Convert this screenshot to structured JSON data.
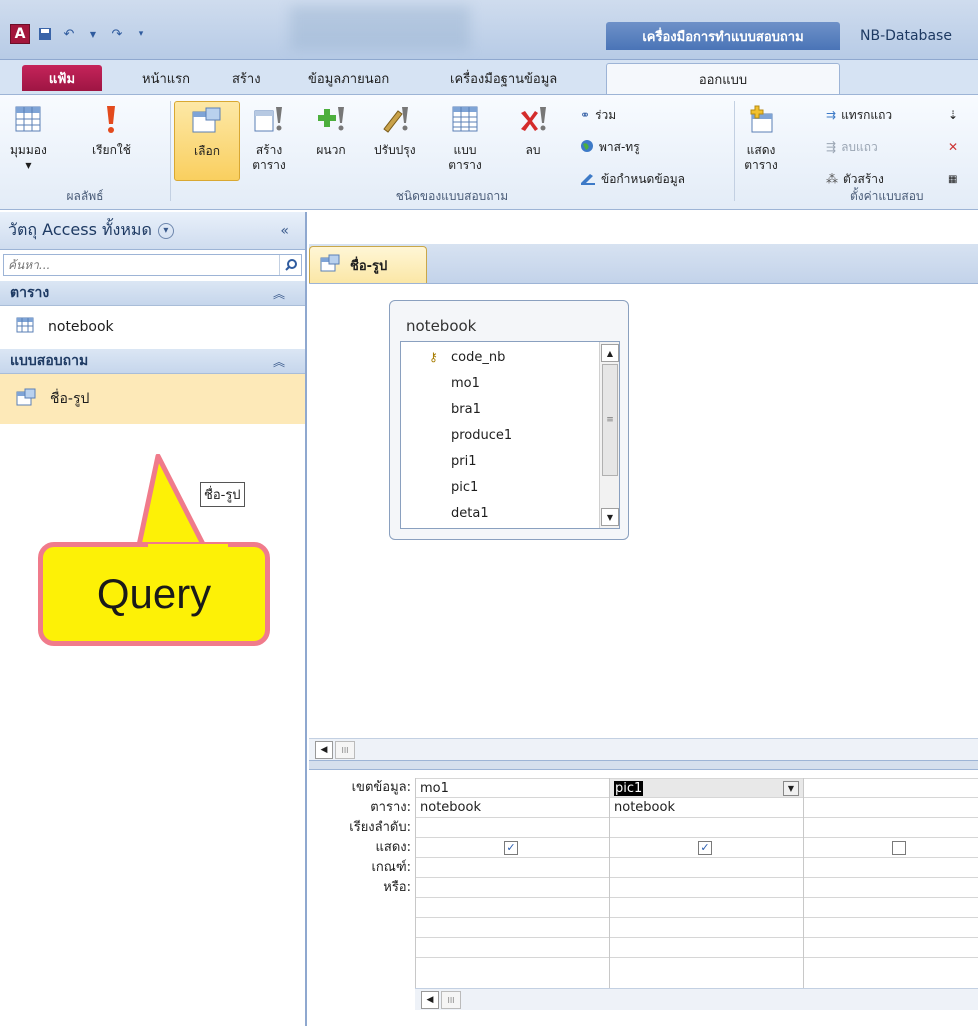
{
  "titlebar": {
    "context_tab_title": "เครื่องมือการทำแบบสอบถาม",
    "window_title": "NB-Database"
  },
  "tabs": {
    "file": "แฟ้ม",
    "home": "หน้าแรก",
    "create": "สร้าง",
    "external": "ข้อมูลภายนอก",
    "dbtools": "เครื่องมือฐานข้อมูล",
    "design": "ออกแบบ"
  },
  "ribbon": {
    "view": "มุมมอง",
    "run": "เรียกใช้",
    "results_group": "ผลลัพธ์",
    "select": "เลือก",
    "make_table_1": "สร้าง",
    "make_table_2": "ตาราง",
    "append": "ผนวก",
    "update": "ปรับปรุง",
    "crosstab_1": "แบบ",
    "crosstab_2": "ตาราง",
    "delete": "ลบ",
    "union": "ร่วม",
    "pass_through": "พาส-ทรู",
    "data_definition": "ข้อกำหนดข้อมูล",
    "query_type_group": "ชนิดของแบบสอบถาม",
    "show_table_1": "แสดง",
    "show_table_2": "ตาราง",
    "insert_rows": "แทรกแถว",
    "delete_rows": "ลบแถว",
    "builder": "ตัวสร้าง",
    "query_setup_group": "ตั้งค่าแบบสอบ"
  },
  "nav": {
    "header": "วัตถุ Access ทั้งหมด",
    "search_placeholder": "ค้นหา...",
    "sections": [
      {
        "title": "ตาราง",
        "items": [
          "notebook"
        ]
      },
      {
        "title": "แบบสอบถาม",
        "items": [
          "ชื่อ-รูป"
        ]
      }
    ],
    "tooltip": "ชื่อ-รูป"
  },
  "callout": {
    "text": "Query"
  },
  "document": {
    "tab_title": "ชื่อ-รูป",
    "table": {
      "name": "notebook",
      "fields": [
        "code_nb",
        "mo1",
        "bra1",
        "produce1",
        "pri1",
        "pic1",
        "deta1"
      ]
    }
  },
  "grid": {
    "row_labels": [
      "เขตข้อมูล:",
      "ตาราง:",
      "เรียงลำดับ:",
      "แสดง:",
      "เกณฑ์:",
      "หรือ:"
    ],
    "columns": [
      {
        "field": "mo1",
        "table": "notebook",
        "show": true
      },
      {
        "field": "pic1",
        "table": "notebook",
        "show": true
      },
      {
        "field": "",
        "table": "",
        "show": false
      }
    ]
  }
}
